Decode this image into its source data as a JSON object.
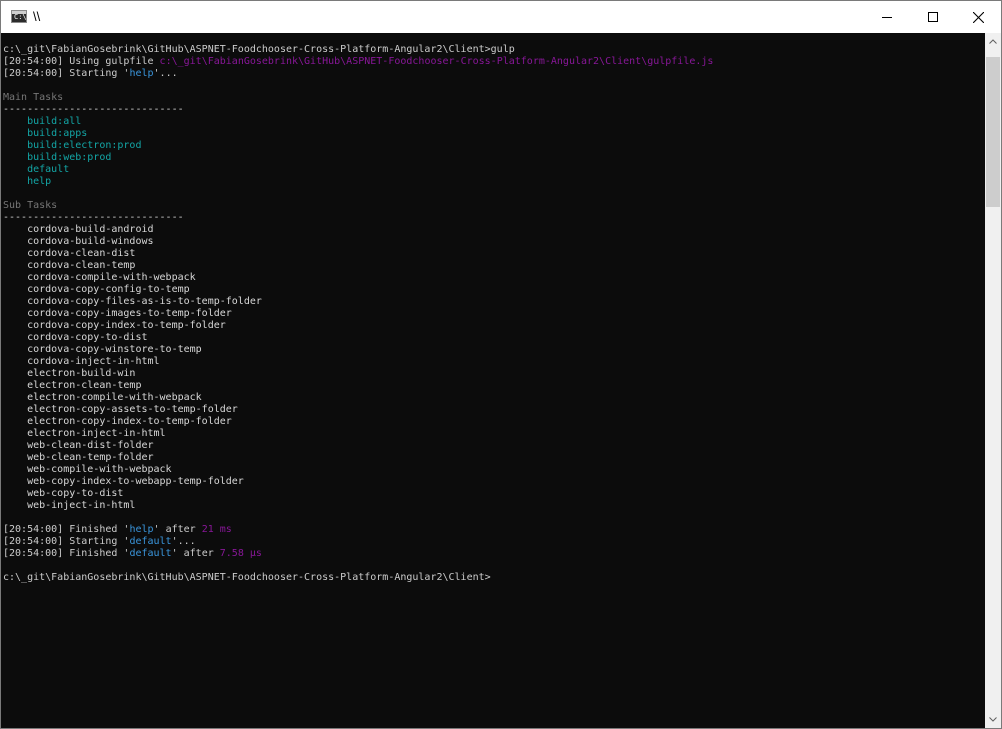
{
  "window": {
    "title": "\\\\",
    "icon": "cmd-console-icon",
    "icon_text": "C:\\"
  },
  "controls": {
    "minimize": "minimize-icon",
    "maximize": "maximize-icon",
    "close": "close-icon"
  },
  "console": {
    "colors": {
      "background": "#0c0c0c",
      "text": "#cccccc",
      "timestamp": "#cccccc",
      "path": "#881798",
      "task_name": "#13a6a6",
      "timing": "#881798",
      "heading": "#767676"
    },
    "lines": [
      [
        {
          "t": "c:\\_git\\FabianGosebrink\\GitHub\\ASPNET-Foodchooser-Cross-Platform-Angular2\\Client>gulp",
          "c": "plain"
        }
      ],
      [
        {
          "t": "[20:54:00] Using gulpfile ",
          "c": "plain"
        },
        {
          "t": "c:\\_git\\FabianGosebrink\\GitHub\\ASPNET-Foodchooser-Cross-Platform-Angular2\\Client\\gulpfile.js",
          "c": "magenta"
        }
      ],
      [
        {
          "t": "[20:54:00] Starting '",
          "c": "plain"
        },
        {
          "t": "help",
          "c": "cyan"
        },
        {
          "t": "'...",
          "c": "plain"
        }
      ],
      [
        {
          "t": "",
          "c": "plain"
        }
      ],
      [
        {
          "t": "Main Tasks",
          "c": "dim"
        }
      ],
      [
        {
          "t": "------------------------------",
          "c": "white"
        }
      ],
      [
        {
          "t": "    build:all",
          "c": "teal"
        }
      ],
      [
        {
          "t": "    build:apps",
          "c": "teal"
        }
      ],
      [
        {
          "t": "    build:electron:prod",
          "c": "teal"
        }
      ],
      [
        {
          "t": "    build:web:prod",
          "c": "teal"
        }
      ],
      [
        {
          "t": "    default",
          "c": "teal"
        }
      ],
      [
        {
          "t": "    help",
          "c": "teal"
        }
      ],
      [
        {
          "t": "",
          "c": "plain"
        }
      ],
      [
        {
          "t": "Sub Tasks",
          "c": "dim"
        }
      ],
      [
        {
          "t": "------------------------------",
          "c": "white"
        }
      ],
      [
        {
          "t": "    cordova-build-android",
          "c": "white"
        }
      ],
      [
        {
          "t": "    cordova-build-windows",
          "c": "white"
        }
      ],
      [
        {
          "t": "    cordova-clean-dist",
          "c": "white"
        }
      ],
      [
        {
          "t": "    cordova-clean-temp",
          "c": "white"
        }
      ],
      [
        {
          "t": "    cordova-compile-with-webpack",
          "c": "white"
        }
      ],
      [
        {
          "t": "    cordova-copy-config-to-temp",
          "c": "white"
        }
      ],
      [
        {
          "t": "    cordova-copy-files-as-is-to-temp-folder",
          "c": "white"
        }
      ],
      [
        {
          "t": "    cordova-copy-images-to-temp-folder",
          "c": "white"
        }
      ],
      [
        {
          "t": "    cordova-copy-index-to-temp-folder",
          "c": "white"
        }
      ],
      [
        {
          "t": "    cordova-copy-to-dist",
          "c": "white"
        }
      ],
      [
        {
          "t": "    cordova-copy-winstore-to-temp",
          "c": "white"
        }
      ],
      [
        {
          "t": "    cordova-inject-in-html",
          "c": "white"
        }
      ],
      [
        {
          "t": "    electron-build-win",
          "c": "white"
        }
      ],
      [
        {
          "t": "    electron-clean-temp",
          "c": "white"
        }
      ],
      [
        {
          "t": "    electron-compile-with-webpack",
          "c": "white"
        }
      ],
      [
        {
          "t": "    electron-copy-assets-to-temp-folder",
          "c": "white"
        }
      ],
      [
        {
          "t": "    electron-copy-index-to-temp-folder",
          "c": "white"
        }
      ],
      [
        {
          "t": "    electron-inject-in-html",
          "c": "white"
        }
      ],
      [
        {
          "t": "    web-clean-dist-folder",
          "c": "white"
        }
      ],
      [
        {
          "t": "    web-clean-temp-folder",
          "c": "white"
        }
      ],
      [
        {
          "t": "    web-compile-with-webpack",
          "c": "white"
        }
      ],
      [
        {
          "t": "    web-copy-index-to-webapp-temp-folder",
          "c": "white"
        }
      ],
      [
        {
          "t": "    web-copy-to-dist",
          "c": "white"
        }
      ],
      [
        {
          "t": "    web-inject-in-html",
          "c": "white"
        }
      ],
      [
        {
          "t": "",
          "c": "plain"
        }
      ],
      [
        {
          "t": "[20:54:00] Finished '",
          "c": "plain"
        },
        {
          "t": "help",
          "c": "cyan"
        },
        {
          "t": "' after ",
          "c": "plain"
        },
        {
          "t": "21 ms",
          "c": "magenta"
        }
      ],
      [
        {
          "t": "[20:54:00] Starting '",
          "c": "plain"
        },
        {
          "t": "default",
          "c": "cyan"
        },
        {
          "t": "'...",
          "c": "plain"
        }
      ],
      [
        {
          "t": "[20:54:00] Finished '",
          "c": "plain"
        },
        {
          "t": "default",
          "c": "cyan"
        },
        {
          "t": "' after ",
          "c": "plain"
        },
        {
          "t": "7.58 μs",
          "c": "magenta"
        }
      ],
      [
        {
          "t": "",
          "c": "plain"
        }
      ],
      [
        {
          "t": "c:\\_git\\FabianGosebrink\\GitHub\\ASPNET-Foodchooser-Cross-Platform-Angular2\\Client>",
          "c": "plain"
        }
      ]
    ]
  },
  "scrollbar": {
    "up": "scroll-up-arrow-icon",
    "down": "scroll-down-arrow-icon"
  }
}
